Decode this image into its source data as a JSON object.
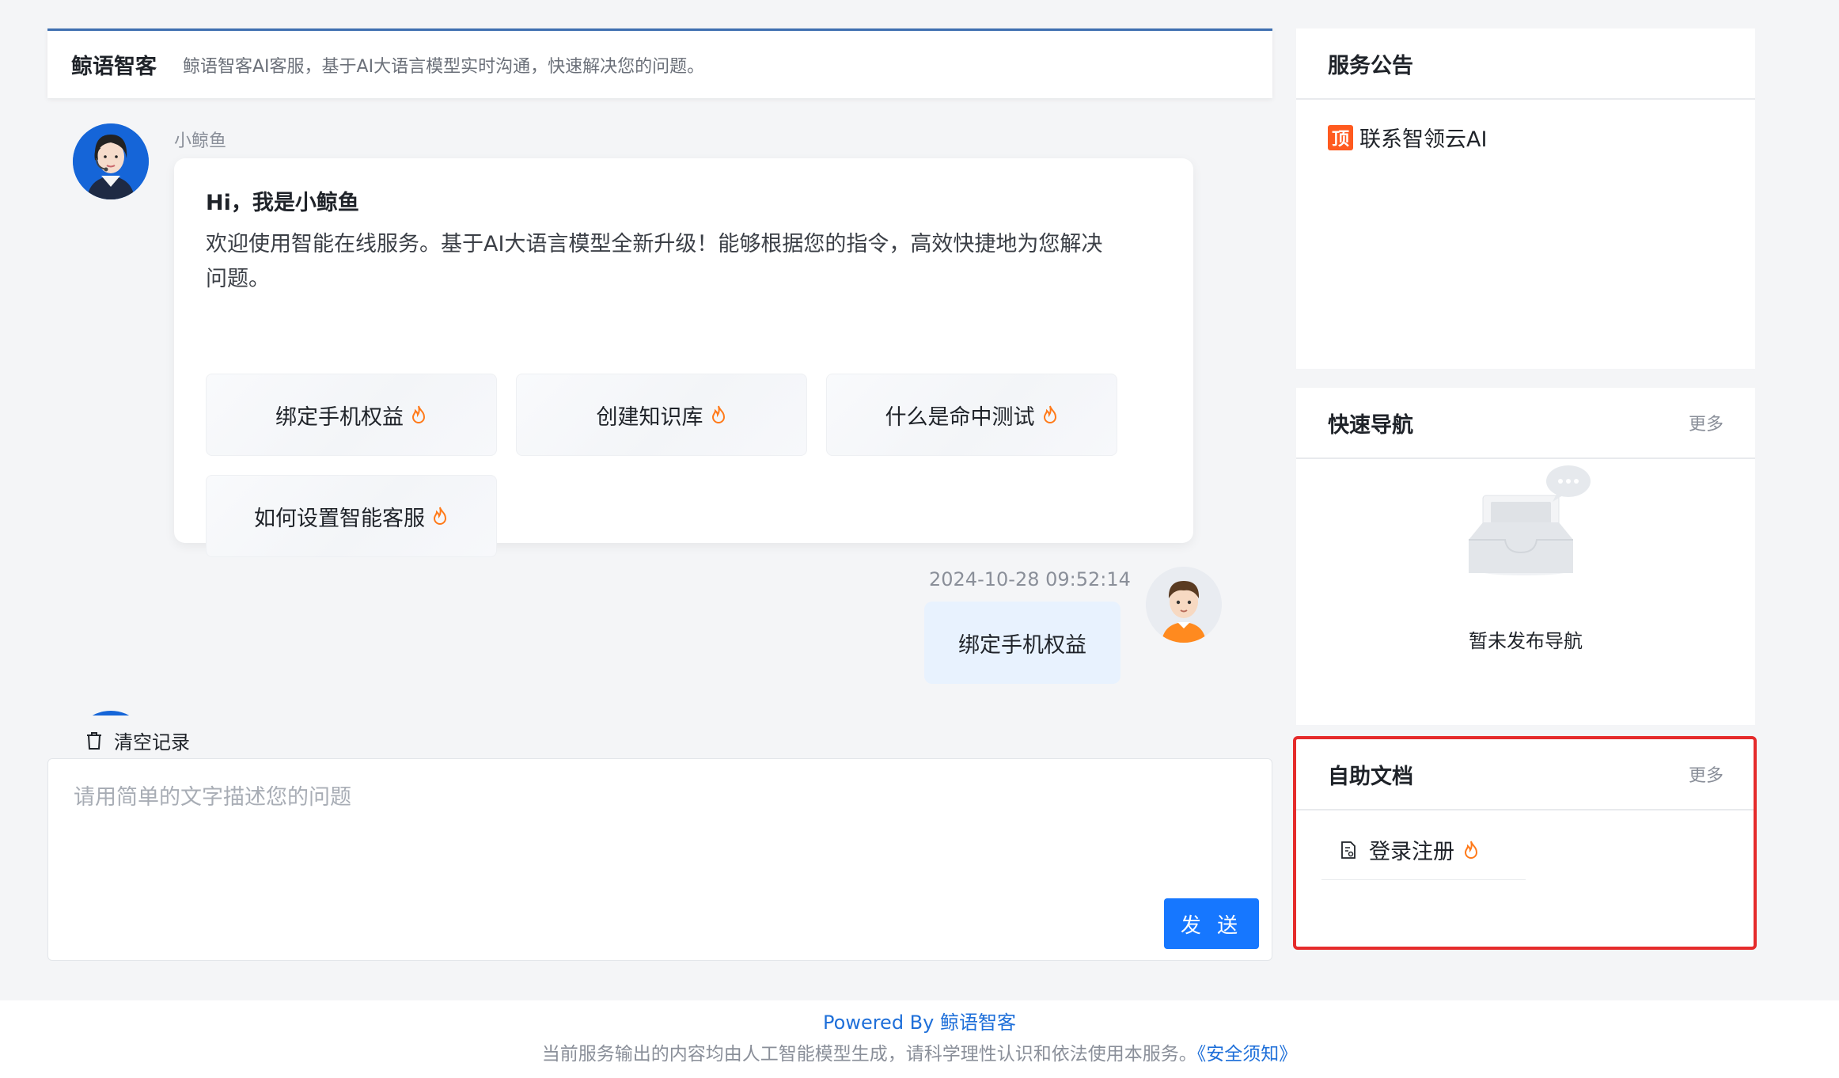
{
  "header": {
    "title": "鲸语智客",
    "description": "鲸语智客AI客服，基于AI大语言模型实时沟通，快速解决您的问题。"
  },
  "bot": {
    "name": "小鲸鱼",
    "greeting": "Hi，我是小鲸鱼",
    "welcome": "欢迎使用智能在线服务。基于AI大语言模型全新升级！能够根据您的指令，高效快捷地为您解决问题。",
    "quick_questions": [
      {
        "label": "绑定手机权益"
      },
      {
        "label": "创建知识库"
      },
      {
        "label": "什么是命中测试"
      },
      {
        "label": "如何设置智能客服"
      }
    ]
  },
  "user_message": {
    "time": "2024-10-28 09:52:14",
    "text": "绑定手机权益"
  },
  "clear_history": "清空记录",
  "input": {
    "placeholder": "请用简单的文字描述您的问题",
    "send_label": "发 送"
  },
  "panels": {
    "notice": {
      "title": "服务公告",
      "badge": "顶",
      "item": "联系智领云AI"
    },
    "nav": {
      "title": "快速导航",
      "more": "更多",
      "empty": "暂未发布导航"
    },
    "docs": {
      "title": "自助文档",
      "more": "更多",
      "items": [
        {
          "label": "登录注册"
        }
      ]
    }
  },
  "footer": {
    "powered": "Powered By 鲸语智客",
    "disclaimer": "当前服务输出的内容均由人工智能模型生成，请科学理性认识和依法使用本服务。",
    "safety_link": "《安全须知》"
  },
  "colors": {
    "accent": "#1677ff",
    "highlight": "#e52b2b",
    "fire": "#ff7a1a"
  }
}
